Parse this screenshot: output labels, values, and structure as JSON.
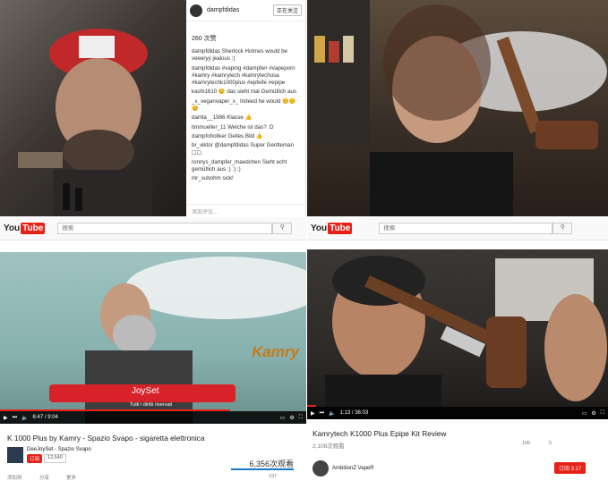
{
  "instagram": {
    "username": "dampfdidas",
    "follow_label": "正在关注",
    "likes": "260 次赞",
    "comments": [
      "dampfdidas Sherlock Holmes would be veeeryy jealous :)",
      "dampfdidas #vaping #dampfen #vapeporn #kamry #kamrytech #kamrytechusa #kamrytechk1000plus #epfeife #epipe",
      "kashi1610 😊 das sieht mal Gemütlich aus",
      "_x_veganvaper_x_ Indeed he would 😊😊😊",
      "damla__1986 Klasse 👍",
      "timmueller_11 Welche ist das? :D",
      "dampfoholiker Geiles Bild 👍",
      "br_viktor @dampfdidas Super Gentleman ☐☐",
      "ronnys_dampfer_maedchen Sieht echt gemütlich aus :) :) :)",
      "mr_subohm sick!"
    ],
    "footer": "添加评论..."
  },
  "youtube_left": {
    "logo_you": "You",
    "logo_tube": "Tube",
    "search_placeholder": "搜索",
    "video_title": "K 1000 Plus by Kamry - Spazio Svapo - sigaretta elettronica",
    "time": "6:47 / 9:04",
    "overlay_brand": "JoySet",
    "overlay_sub": "Tutti i diritti riservati",
    "watermark": "Kamry",
    "channel": "DeeJoySet - Spazio Svapo",
    "subscribe": "订阅",
    "sub_count": "12,540",
    "views": "6,356次观看",
    "actions": [
      "添加到",
      "分享",
      "更多"
    ],
    "likes": "197"
  },
  "youtube_right": {
    "logo_you": "You",
    "logo_tube": "Tube",
    "search_placeholder": "搜索",
    "video_title": "Kamrytech K1000 Plus Epipe Kit Review",
    "time": "1:13 / 36:03",
    "views": "2,108次观看",
    "likes": "106",
    "dislikes": "5",
    "channel": "AmbitionZ VapeR",
    "subscribe": "订阅 3.17"
  },
  "colors": {
    "yt_red": "#e62117",
    "joyset_red": "#d8222a",
    "kamry_orange": "#c57b17"
  }
}
